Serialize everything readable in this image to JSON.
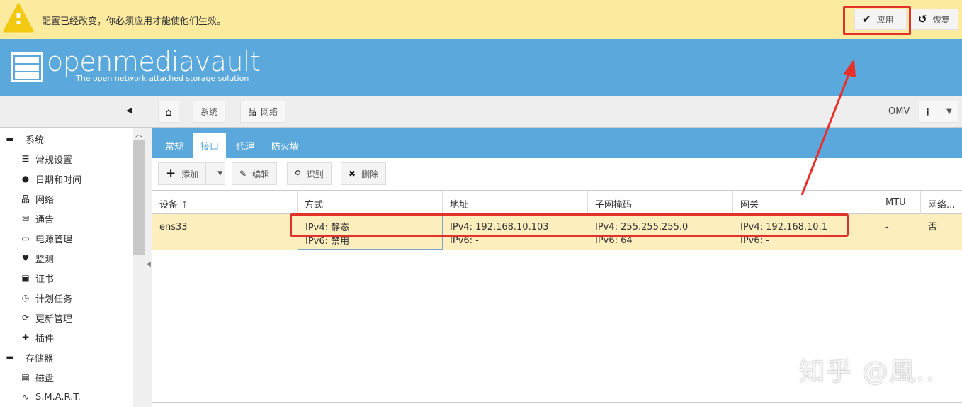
{
  "banner": {
    "message": "配置已经改变，你必须应用才能使他们生效。",
    "apply_label": "应用",
    "revert_label": "恢复",
    "color": "#fcea9f"
  },
  "header": {
    "logo_title": "openmediavault",
    "logo_subtitle": "The open network attached storage solution",
    "color": "#5aa8dc"
  },
  "toolbar": {
    "breadcrumb": [
      "系统",
      "网络"
    ],
    "hostname": "OMV"
  },
  "sidebar": {
    "items": [
      {
        "label": "系统",
        "icon": "minus-square-icon",
        "group": true
      },
      {
        "label": "常规设置",
        "icon": "sliders-icon"
      },
      {
        "label": "日期和时间",
        "icon": "clock-icon"
      },
      {
        "label": "网络",
        "icon": "sitemap-icon"
      },
      {
        "label": "通告",
        "icon": "envelope-icon"
      },
      {
        "label": "电源管理",
        "icon": "battery-icon"
      },
      {
        "label": "监测",
        "icon": "heartbeat-icon"
      },
      {
        "label": "证书",
        "icon": "certificate-icon"
      },
      {
        "label": "计划任务",
        "icon": "calendar-clock-icon"
      },
      {
        "label": "更新管理",
        "icon": "refresh-icon"
      },
      {
        "label": "插件",
        "icon": "puzzle-icon"
      },
      {
        "label": "存储器",
        "icon": "minus-square-icon",
        "group": true
      },
      {
        "label": "磁盘",
        "icon": "hdd-icon"
      },
      {
        "label": "S.M.A.R.T.",
        "icon": "pulse-icon"
      }
    ]
  },
  "tabs": [
    "常规",
    "接口",
    "代理",
    "防火墙"
  ],
  "grid_toolbar": {
    "add": "添加",
    "edit": "编辑",
    "identify": "识别",
    "delete": "删除"
  },
  "table": {
    "columns": [
      "设备",
      "方式",
      "地址",
      "子网掩码",
      "网关",
      "MTU",
      "网络..."
    ],
    "rows": [
      {
        "device": "ens33",
        "method": [
          "IPv4: 静态",
          "IPv6: 禁用"
        ],
        "address": [
          "IPv4: 192.168.10.103",
          "IPv6: -"
        ],
        "netmask": [
          "IPv4: 255.255.255.0",
          "IPv6: 64"
        ],
        "gateway": [
          "IPv4: 192.168.10.1",
          "IPv6: -"
        ],
        "mtu": "-",
        "wol": "否"
      }
    ]
  },
  "watermark": "知乎 @風..."
}
